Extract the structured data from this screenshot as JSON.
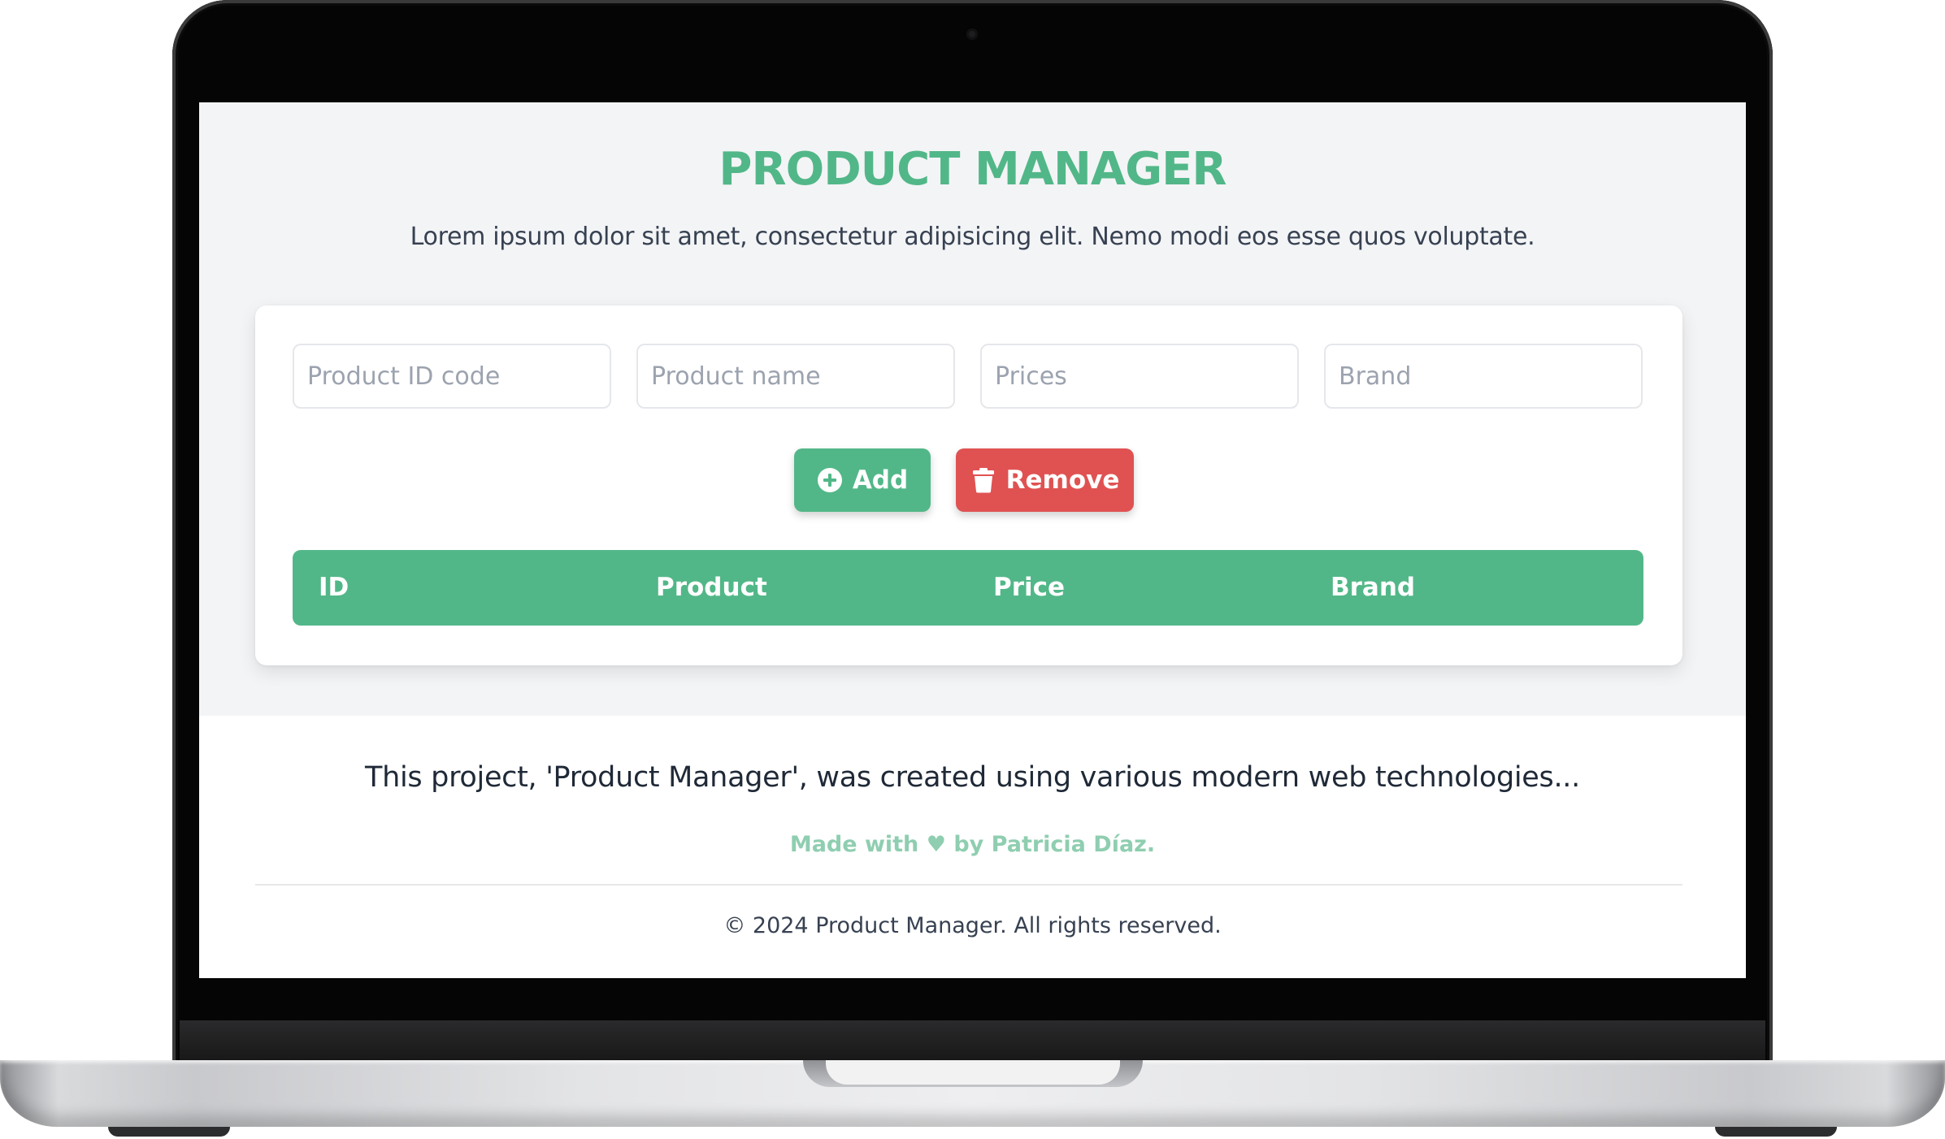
{
  "app": {
    "title": "PRODUCT MANAGER",
    "subtitle": "Lorem ipsum dolor sit amet, consectetur adipisicing elit. Nemo modi eos esse quos voluptate."
  },
  "form": {
    "product_id_placeholder": "Product ID code",
    "product_name_placeholder": "Product name",
    "price_placeholder": "Prices",
    "brand_placeholder": "Brand"
  },
  "actions": {
    "add_label": "Add",
    "add_icon": "plus-circle-icon",
    "remove_label": "Remove",
    "remove_icon": "trash-icon"
  },
  "table": {
    "columns": [
      "ID",
      "Product",
      "Price",
      "Brand"
    ],
    "rows": []
  },
  "footer": {
    "description": "This project, 'Product Manager', was created using various modern web technologies...",
    "made_with_prefix": "Made with",
    "heart": "♥",
    "made_with_suffix": "by Patricia Díaz.",
    "copyright": "© 2024 Product Manager. All rights reserved."
  },
  "colors": {
    "accent_green": "#52b788",
    "danger_red": "#e05252",
    "muted_green_text": "#8fceb0",
    "page_background": "#f3f4f6"
  }
}
